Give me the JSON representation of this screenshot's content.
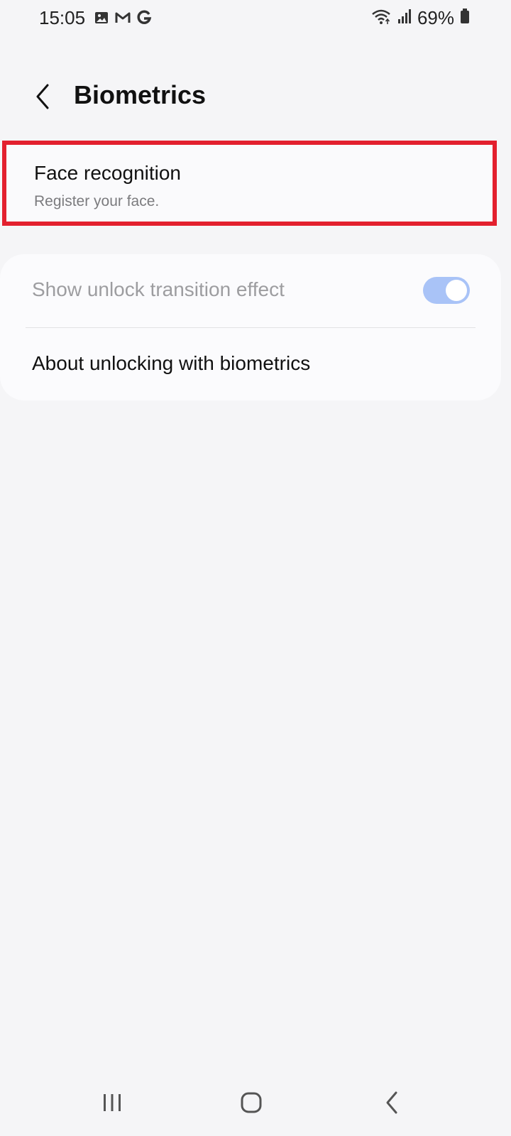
{
  "status_bar": {
    "time": "15:05",
    "battery_percent": "69%",
    "left_icons": [
      "gallery-icon",
      "gmail-icon",
      "google-icon"
    ],
    "right_icons": [
      "wifi-icon",
      "signal-icon",
      "battery-icon"
    ]
  },
  "header": {
    "title": "Biometrics",
    "back_icon": "chevron-left-icon"
  },
  "face_recognition": {
    "title": "Face recognition",
    "subtitle": "Register your face.",
    "highlight_color": "#e3202e"
  },
  "settings": {
    "show_unlock_transition": {
      "label": "Show unlock transition effect",
      "enabled": true,
      "toggle_color": "#a9c3f7"
    },
    "about": {
      "label": "About unlocking with biometrics"
    }
  },
  "nav_bar": {
    "buttons": [
      "recents-icon",
      "home-icon",
      "back-icon"
    ]
  }
}
